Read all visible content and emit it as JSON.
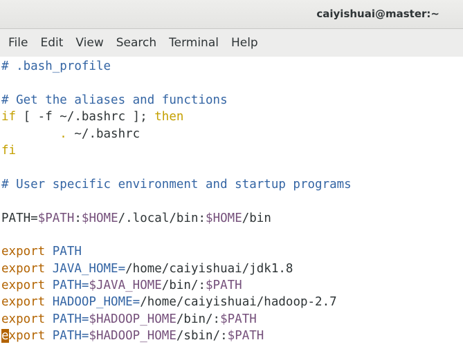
{
  "window": {
    "title": "caiyishuai@master:~"
  },
  "menu": {
    "items": [
      "File",
      "Edit",
      "View",
      "Search",
      "Terminal",
      "Help"
    ]
  },
  "terminal": {
    "l1": "# .bash_profile",
    "l3": "# Get the aliases and functions",
    "l4_a": "if",
    "l4_b": " [ -f ~/.bashrc ]; ",
    "l4_c": "then",
    "l5_a": "        ",
    "l5_b": ".",
    "l5_c": " ~/.bashrc",
    "l6": "fi",
    "l8": "# User specific environment and startup programs",
    "l10_a": "PATH=",
    "l10_b": "$PATH",
    "l10_c": ":",
    "l10_d": "$HOME",
    "l10_e": "/.local/bin:",
    "l10_f": "$HOME",
    "l10_g": "/bin",
    "l12_a": "export",
    "l12_b": " PATH",
    "l13_a": "export",
    "l13_b": " JAVA_HOME=",
    "l13_c": "/home/caiyishuai/jdk1.8",
    "l14_a": "export",
    "l14_b": " PATH=",
    "l14_c": "$JAVA_HOME",
    "l14_d": "/bin/:",
    "l14_e": "$PATH",
    "l15_a": "export",
    "l15_b": " HADOOP_HOME=",
    "l15_c": "/home/caiyishuai/hadoop-2.7",
    "l16_a": "export",
    "l16_b": " PATH=",
    "l16_c": "$HADOOP_HOME",
    "l16_d": "/bin/:",
    "l16_e": "$PATH",
    "l17_cursor": "e",
    "l17_a": "xport",
    "l17_b": " PATH=",
    "l17_c": "$HADOOP_HOME",
    "l17_d": "/sbin/:",
    "l17_e": "$PATH"
  },
  "colors": {
    "comment": "#3465a4",
    "keyword": "#c4a000",
    "export": "#b26300",
    "variable": "#75507b",
    "text": "#2e3436",
    "cursor": "#b26300"
  }
}
